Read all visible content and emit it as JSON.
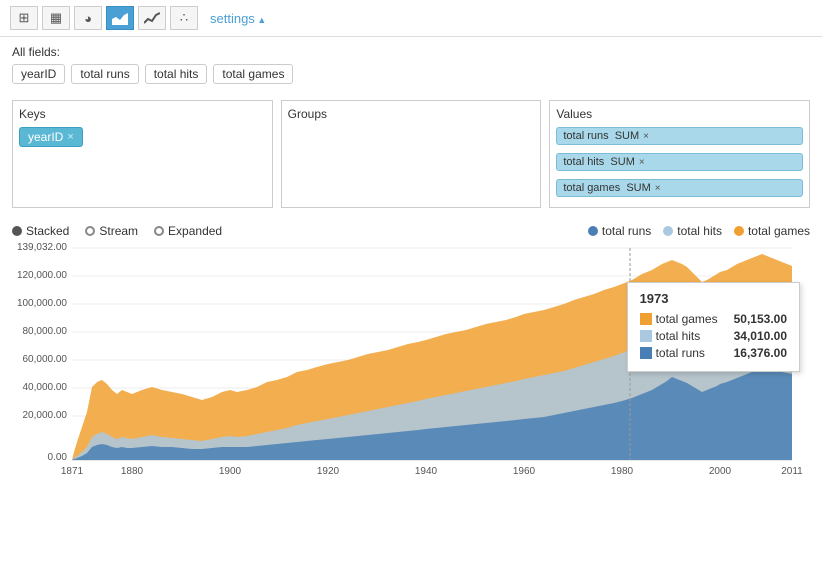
{
  "toolbar": {
    "buttons": [
      {
        "id": "grid",
        "icon": "⊞",
        "label": "grid-icon"
      },
      {
        "id": "bar",
        "icon": "▦",
        "label": "bar-chart-icon"
      },
      {
        "id": "pie",
        "icon": "◑",
        "label": "pie-chart-icon"
      },
      {
        "id": "area",
        "icon": "▲",
        "label": "area-chart-icon",
        "active": true
      },
      {
        "id": "line",
        "icon": "╱",
        "label": "line-chart-icon"
      },
      {
        "id": "scatter",
        "icon": "∴",
        "label": "scatter-chart-icon"
      }
    ],
    "settings_label": "settings"
  },
  "fields": {
    "label": "All fields:",
    "items": [
      "yearID",
      "total runs",
      "total hits",
      "total games"
    ]
  },
  "keys": {
    "title": "Keys",
    "items": [
      {
        "label": "yearID",
        "removable": true
      }
    ]
  },
  "groups": {
    "title": "Groups",
    "items": []
  },
  "values": {
    "title": "Values",
    "items": [
      {
        "label": "total runs  SUM",
        "removable": true
      },
      {
        "label": "total hits  SUM",
        "removable": true
      },
      {
        "label": "total games  SUM",
        "removable": true
      }
    ]
  },
  "chart": {
    "y_axis_label": "139,032.00",
    "y_ticks": [
      "139,032.00",
      "120,000.00",
      "100,000.00",
      "80,000.00",
      "60,000.00",
      "40,000.00",
      "20,000.00",
      "0.00"
    ],
    "x_ticks": [
      "1871",
      "1880",
      "1900",
      "1920",
      "1940",
      "1960",
      "1980",
      "2000",
      "2011"
    ],
    "controls": {
      "stacked": {
        "label": "Stacked",
        "selected": true
      },
      "stream": {
        "label": "Stream",
        "selected": false
      },
      "expanded": {
        "label": "Expanded",
        "selected": false
      }
    },
    "legend": [
      {
        "label": "total runs",
        "color": "#4a7fb5"
      },
      {
        "label": "total hits",
        "color": "#aac9e0"
      },
      {
        "label": "total games",
        "color": "#f0a030"
      }
    ],
    "tooltip": {
      "year": "1973",
      "rows": [
        {
          "label": "total games",
          "value": "50,153.00",
          "color": "#f0a030"
        },
        {
          "label": "total hits",
          "value": "34,010.00",
          "color": "#aac9e0"
        },
        {
          "label": "total runs",
          "value": "16,376.00",
          "color": "#4a7fb5"
        }
      ]
    },
    "colors": {
      "total_runs": "#4a7fb5",
      "total_hits": "#aac9e0",
      "total_games": "#f0a030"
    }
  }
}
